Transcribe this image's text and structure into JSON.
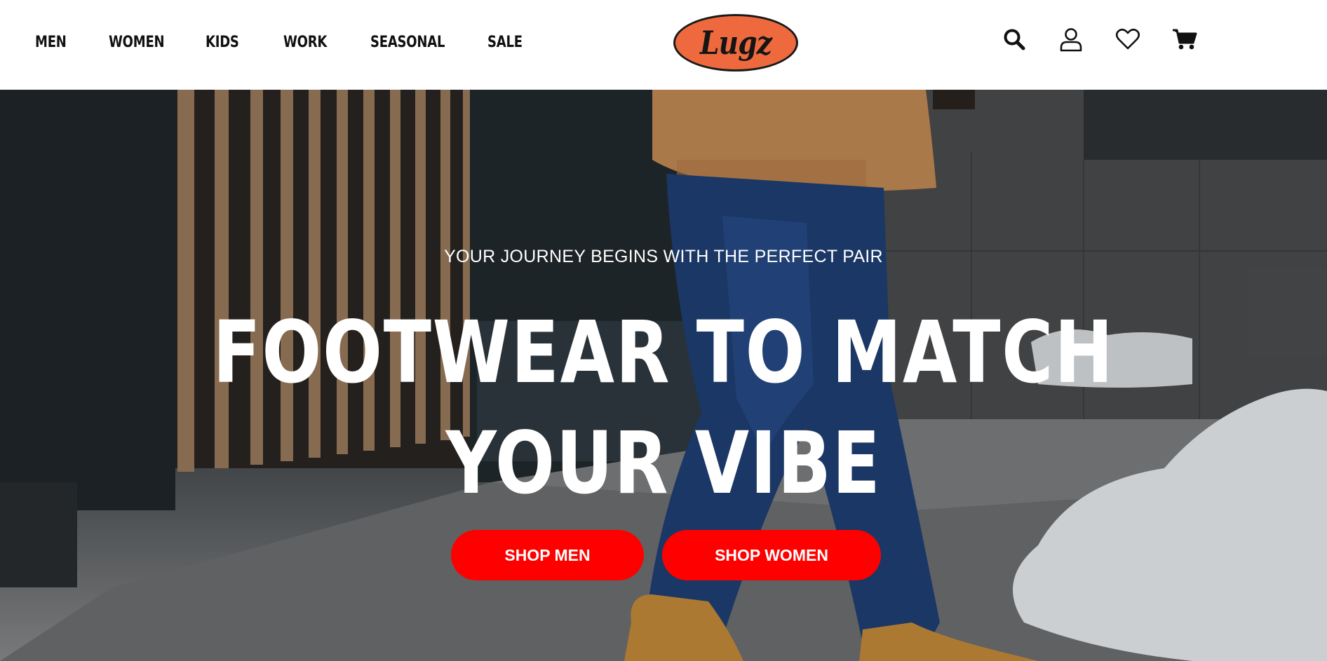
{
  "brand": {
    "name": "Lugz",
    "color": "#ee6a3e"
  },
  "nav": {
    "items": [
      {
        "label": "MEN"
      },
      {
        "label": "WOMEN"
      },
      {
        "label": "KIDS"
      },
      {
        "label": "WORK"
      },
      {
        "label": "SEASONAL"
      },
      {
        "label": "SALE"
      }
    ]
  },
  "header_icons": [
    {
      "name": "search-icon"
    },
    {
      "name": "account-icon"
    },
    {
      "name": "wishlist-heart-icon"
    },
    {
      "name": "cart-icon"
    }
  ],
  "hero": {
    "tagline": "YOUR JOURNEY BEGINS WITH THE PERFECT PAIR",
    "headline_line1": "FOOTWEAR TO MATCH",
    "headline_line2": "YOUR VIBE",
    "cta_men": "SHOP MEN",
    "cta_women": "SHOP WOMEN",
    "cta_color": "#ff0000"
  }
}
